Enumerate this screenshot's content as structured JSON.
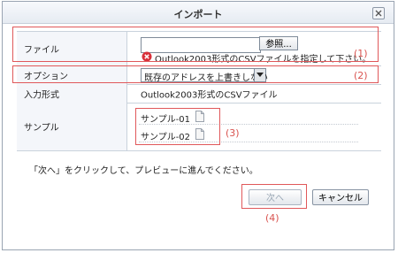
{
  "dialog": {
    "title": "インポート",
    "close_label": "×"
  },
  "form": {
    "file": {
      "label": "ファイル",
      "browse_label": "参照...",
      "input_value": "",
      "error_text": "Outlook2003形式のCSVファイルを指定して下さい。"
    },
    "option": {
      "label": "オプション",
      "selected": "既存のアドレスを上書きしない"
    },
    "format": {
      "label": "入力形式",
      "value": "Outlook2003形式のCSVファイル"
    },
    "sample": {
      "label": "サンプル",
      "items": [
        "サンプル-01",
        "サンプル-02"
      ]
    }
  },
  "hint": "「次へ」をクリックして、プレビューに進んでください。",
  "buttons": {
    "next": "次へ",
    "cancel": "キャンセル"
  },
  "callouts": [
    "(1)",
    "(2)",
    "(3)",
    "(4)"
  ],
  "colors": {
    "callout": "#d9534f",
    "error": "#d9303a"
  }
}
